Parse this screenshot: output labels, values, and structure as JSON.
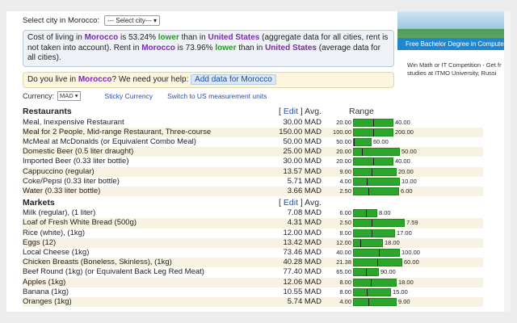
{
  "city_select": {
    "label": "Select city in Morocco:",
    "value": "--- Select city---"
  },
  "info": {
    "p1": "Cost of living in ",
    "country": "Morocco",
    "p2": " is 53.24% ",
    "lower1": "lower",
    "p3": " than in ",
    "us1": "United States",
    "p4": " (aggregate data for all cities, rent is not taken into account). Rent in ",
    "country2": "Morocco",
    "p5": " is 73.96% ",
    "lower2": "lower",
    "p6": " than in ",
    "us2": "United States",
    "p7": " (average data for all cities)."
  },
  "help": {
    "p1": "Do you live in ",
    "country": "Morocco",
    "p2": "? We need your help:",
    "button": "Add data for Morocco"
  },
  "currency": {
    "label": "Currency:",
    "value": "MAD",
    "sticky": "Sticky Currency",
    "switch": "Switch to US measurement units"
  },
  "headers": {
    "edit": "Edit",
    "avg": "Avg.",
    "range": "Range"
  },
  "colors": {
    "bar_green": "#2ba52b",
    "link_blue": "#2a4fa8",
    "highlight_purple": "#7a2ab0",
    "highlight_green": "#20a020"
  },
  "sections": [
    {
      "title": "Restaurants",
      "items": [
        {
          "name": "Meal, Inexpensive Restaurant",
          "price": "30.00 MAD",
          "low": "20.00",
          "high": "40.00",
          "avg_frac": 0.5
        },
        {
          "name": "Meal for 2 People, Mid-range Restaurant, Three-course",
          "price": "150.00 MAD",
          "low": "100.00",
          "high": "200.00",
          "avg_frac": 0.5
        },
        {
          "name": "McMeal at McDonalds (or Equivalent Combo Meal)",
          "price": "50.00 MAD",
          "low": "50.00",
          "high": "60.00",
          "avg_frac": 0.0
        },
        {
          "name": "Domestic Beer (0.5 liter draught)",
          "price": "25.00 MAD",
          "low": "20.00",
          "high": "50.00",
          "avg_frac": 0.17
        },
        {
          "name": "Imported Beer (0.33 liter bottle)",
          "price": "30.00 MAD",
          "low": "20.00",
          "high": "40.00",
          "avg_frac": 0.5
        },
        {
          "name": "Cappuccino (regular)",
          "price": "13.57 MAD",
          "low": "9.00",
          "high": "20.00",
          "avg_frac": 0.42
        },
        {
          "name": "Coke/Pepsi (0.33 liter bottle)",
          "price": "5.71 MAD",
          "low": "4.00",
          "high": "10.00",
          "avg_frac": 0.29
        },
        {
          "name": "Water (0.33 liter bottle)",
          "price": "3.66 MAD",
          "low": "2.50",
          "high": "6.00",
          "avg_frac": 0.33
        }
      ]
    },
    {
      "title": "Markets",
      "items": [
        {
          "name": "Milk (regular), (1 liter)",
          "price": "7.08 MAD",
          "low": "6.00",
          "high": "8.00",
          "avg_frac": 0.54
        },
        {
          "name": "Loaf of Fresh White Bread (500g)",
          "price": "4.31 MAD",
          "low": "2.50",
          "high": "7.59",
          "avg_frac": 0.36
        },
        {
          "name": "Rice (white), (1kg)",
          "price": "12.00 MAD",
          "low": "8.00",
          "high": "17.00",
          "avg_frac": 0.44
        },
        {
          "name": "Eggs (12)",
          "price": "13.42 MAD",
          "low": "12.00",
          "high": "18.00",
          "avg_frac": 0.24
        },
        {
          "name": "Local Cheese (1kg)",
          "price": "73.46 MAD",
          "low": "40.00",
          "high": "100.00",
          "avg_frac": 0.56
        },
        {
          "name": "Chicken Breasts (Boneless, Skinless), (1kg)",
          "price": "40.28 MAD",
          "low": "21.38",
          "high": "60.00",
          "avg_frac": 0.49
        },
        {
          "name": "Beef Round (1kg) (or Equivalent Back Leg Red Meat)",
          "price": "77.40 MAD",
          "low": "65.00",
          "high": "90.00",
          "avg_frac": 0.5
        },
        {
          "name": "Apples (1kg)",
          "price": "12.06 MAD",
          "low": "8.00",
          "high": "18.00",
          "avg_frac": 0.41
        },
        {
          "name": "Banana (1kg)",
          "price": "10.55 MAD",
          "low": "8.00",
          "high": "15.00",
          "avg_frac": 0.36
        },
        {
          "name": "Oranges (1kg)",
          "price": "5.74 MAD",
          "low": "4.00",
          "high": "9.00",
          "avg_frac": 0.35
        }
      ]
    }
  ],
  "sidebar": {
    "ad_caption": "Free Bachelor Degree in Compute",
    "ad_line1": "Win Math or IT Competition - Get fr",
    "ad_line2": "studies at ITMO University, Russi"
  }
}
